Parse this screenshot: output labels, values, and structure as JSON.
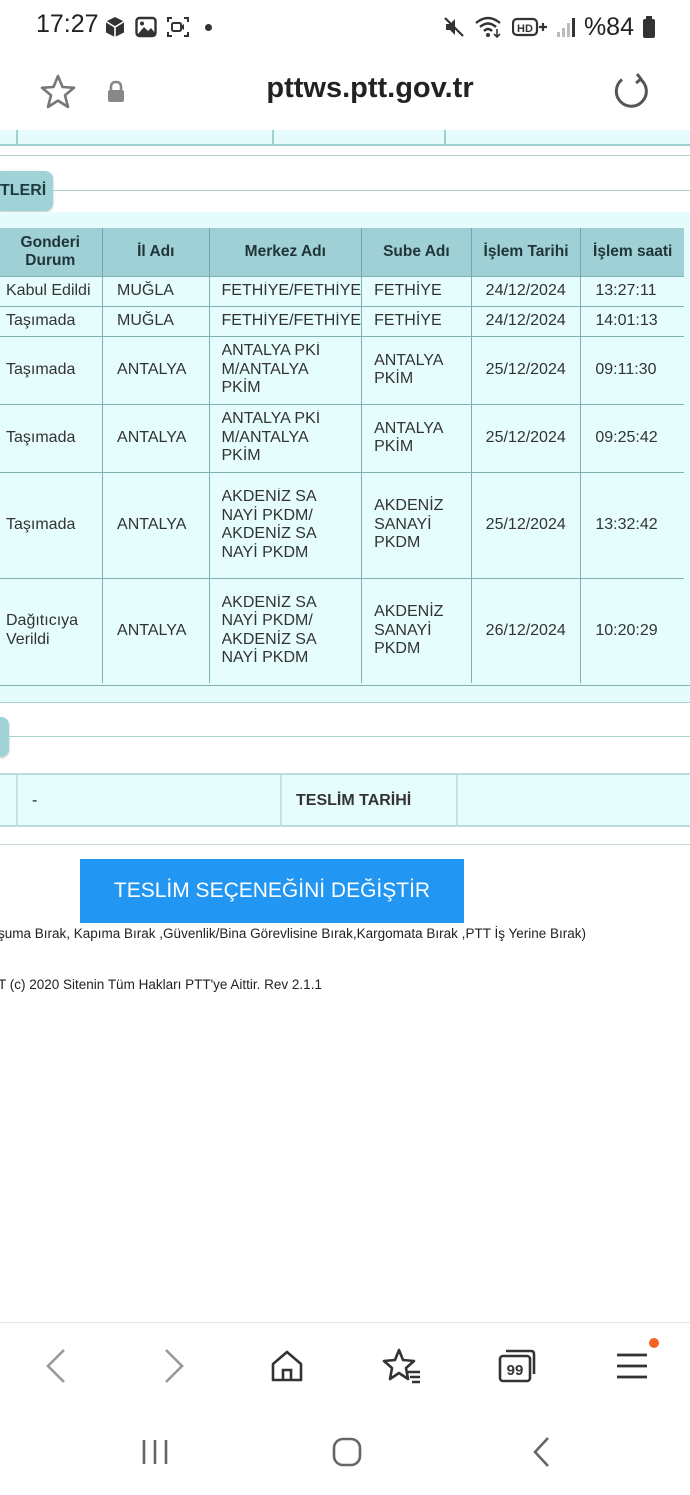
{
  "status_bar": {
    "time": "17:27",
    "battery_percent": "%84",
    "icons_left": [
      "package-icon",
      "gallery-icon",
      "screen-record-icon",
      "notification-dot"
    ],
    "icons_right": [
      "mute-icon",
      "wifi-icon",
      "hd-plus-icon",
      "signal-icon",
      "battery-icon"
    ]
  },
  "browser": {
    "url": "pttws.ptt.gov.tr"
  },
  "section": {
    "title": "TLERİ"
  },
  "table": {
    "headers": [
      "Gonderi Durum",
      "İl Adı",
      "Merkez Adı",
      "Sube Adı",
      "İşlem Tarihi",
      "İşlem saati"
    ],
    "rows": [
      {
        "status": "Kabul Edildi",
        "il": "MUĞLA",
        "merkez": "FETHİYE/FETHİYE",
        "sube": "FETHİYE",
        "date": "24/12/2024",
        "time": "13:27:11"
      },
      {
        "status": "Taşımada",
        "il": "MUĞLA",
        "merkez": "FETHİYE/FETHİYE",
        "sube": "FETHİYE",
        "date": "24/12/2024",
        "time": "14:01:13"
      },
      {
        "status": "Taşımada",
        "il": "ANTALYA",
        "merkez": "ANTALYA PKİM/ANTALYA PKİM",
        "sube": "ANTALYA PKİM",
        "date": "25/12/2024",
        "time": "09:11:30"
      },
      {
        "status": "Taşımada",
        "il": "ANTALYA",
        "merkez": "ANTALYA PKİM/ANTALYA PKİM",
        "sube": "ANTALYA PKİM",
        "date": "25/12/2024",
        "time": "09:25:42"
      },
      {
        "status": "Taşımada",
        "il": "ANTALYA",
        "merkez": "AKDENİZ SANAYİ PKDM/AKDENİZ SANAYİ PKDM",
        "sube": "AKDENİZ SANAYİ PKDM",
        "date": "25/12/2024",
        "time": "13:32:42"
      },
      {
        "status": "Dağıtıcıya Verildi",
        "il": "ANTALYA",
        "merkez": "AKDENİZ SANAYİ PKDM/AKDENİZ SANAYİ PKDM",
        "sube": "AKDENİZ SANAYİ PKDM",
        "date": "26/12/2024",
        "time": "10:20:29"
      }
    ]
  },
  "delivery": {
    "value": "-",
    "label": "TESLİM TARİHİ",
    "date_value": ""
  },
  "change_button_label": "TESLİM SEÇENEĞİNİ DEĞİŞTİR",
  "options_text": "şuma Bırak, Kapıma Bırak ,Güvenlik/Bina Görevlisine Bırak,Kargomata Bırak ,PTT İş Yerine Bırak)",
  "footer_text": "T (c) 2020 Sitenin Tüm Hakları PTT'ye Aittir. Rev 2.1.1",
  "toolbar": {
    "tabs_count": "99"
  },
  "colors": {
    "panel_bg": "#e4fcfc",
    "header_bg": "#9fd0d5",
    "button_bg": "#2196f3",
    "notification": "#f26522"
  }
}
